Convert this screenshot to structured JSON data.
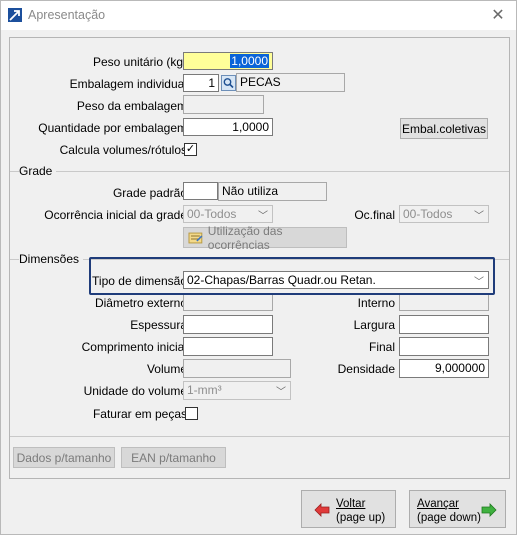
{
  "window": {
    "title": "Apresentação",
    "close": "✕"
  },
  "main": {
    "peso_unitario": {
      "label": "Peso unitário (kg)",
      "value": "1,0000"
    },
    "embalagem_individual": {
      "label": "Embalagem individual",
      "code": "1",
      "desc": "PECAS"
    },
    "peso_embalagem": {
      "label": "Peso da embalagem",
      "value": ""
    },
    "quantidade_embalagem": {
      "label": "Quantidade por embalagem",
      "value": "1,0000"
    },
    "embal_coletivas_button": "Embal.coletivas",
    "calcula_volumes": {
      "label": "Calcula volumes/rótulos",
      "checked": true,
      "mark": "✓"
    }
  },
  "grade": {
    "title": "Grade",
    "grade_padrao": {
      "label": "Grade padrão",
      "code": "",
      "desc": "Não utiliza"
    },
    "ocorrencia_inicial": {
      "label": "Ocorrência inicial da grade",
      "value": "00-Todos"
    },
    "oc_final": {
      "label": "Oc.final",
      "value": "00-Todos"
    },
    "utilizacao_button": "Utilização das ocorrências"
  },
  "dimensoes": {
    "title": "Dimensões",
    "tipo_dimensao": {
      "label": "Tipo de dimensão",
      "value": "02-Chapas/Barras Quadr.ou Retan."
    },
    "diametro_externo": {
      "label": "Diâmetro externo",
      "value": ""
    },
    "interno": {
      "label": "Interno",
      "value": ""
    },
    "espessura": {
      "label": "Espessura",
      "value": ""
    },
    "largura": {
      "label": "Largura",
      "value": ""
    },
    "comprimento_inicial": {
      "label": "Comprimento inicial",
      "value": ""
    },
    "final": {
      "label": "Final",
      "value": ""
    },
    "volume": {
      "label": "Volume",
      "value": ""
    },
    "densidade": {
      "label": "Densidade",
      "value": "9,000000"
    },
    "unidade_volume": {
      "label": "Unidade do volume",
      "value": "1-mm³"
    },
    "faturar_pecas": {
      "label": "Faturar em peças",
      "checked": false
    }
  },
  "bottom_buttons": {
    "dados_tamanho": "Dados p/tamanho",
    "ean_tamanho": "EAN p/tamanho"
  },
  "nav": {
    "voltar": {
      "line1": "Voltar",
      "line2": "(page up)"
    },
    "avancar": {
      "line1": "Avançar",
      "line2": "(page down)"
    }
  },
  "colors": {
    "highlight_field": "#ffff99",
    "selection": "#0a64d8",
    "focus_border": "#1f3c7a",
    "back_arrow": "#e03a3a",
    "next_arrow": "#3fb13f"
  }
}
